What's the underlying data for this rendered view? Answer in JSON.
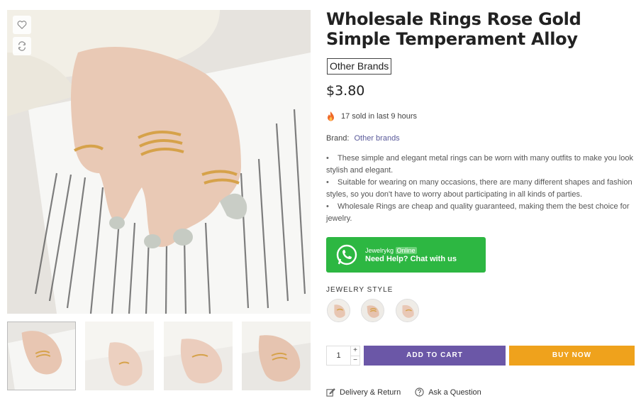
{
  "product": {
    "title": "Wholesale Rings Rose Gold Simple Temperament Alloy",
    "brand_badge": "Other Brands",
    "price": "$3.80",
    "sold_text": "17 sold in last 9 hours",
    "brand_label": "Brand:",
    "brand_value": "Other brands",
    "bullets": [
      "These simple and elegant metal rings can be worn with many outfits to make you look stylish and elegant.",
      "Suitable for wearing on many occasions, there are many different shapes and fashion styles, so you don't have to worry about participating in all kinds of parties.",
      "Wholesale Rings are cheap and quality guaranteed, making them the best choice for jewelry."
    ]
  },
  "whatsapp": {
    "name": "Jewelrykg",
    "status": "Online",
    "cta": "Need Help? Chat with us",
    "color": "#2db742"
  },
  "options": {
    "label": "JEWELRY STYLE",
    "swatches": [
      "style-1",
      "style-2",
      "style-3"
    ]
  },
  "cart": {
    "quantity": "1",
    "plus": "+",
    "minus": "−",
    "add_to_cart": "ADD TO CART",
    "buy_now": "BUY NOW",
    "add_color": "#6b57a7",
    "buy_color": "#efa21c"
  },
  "links": {
    "delivery": "Delivery & Return",
    "ask": "Ask a Question"
  },
  "icons": [
    "heart-icon",
    "compare-icon",
    "fire-icon",
    "whatsapp-icon",
    "edit-icon",
    "question-icon"
  ]
}
